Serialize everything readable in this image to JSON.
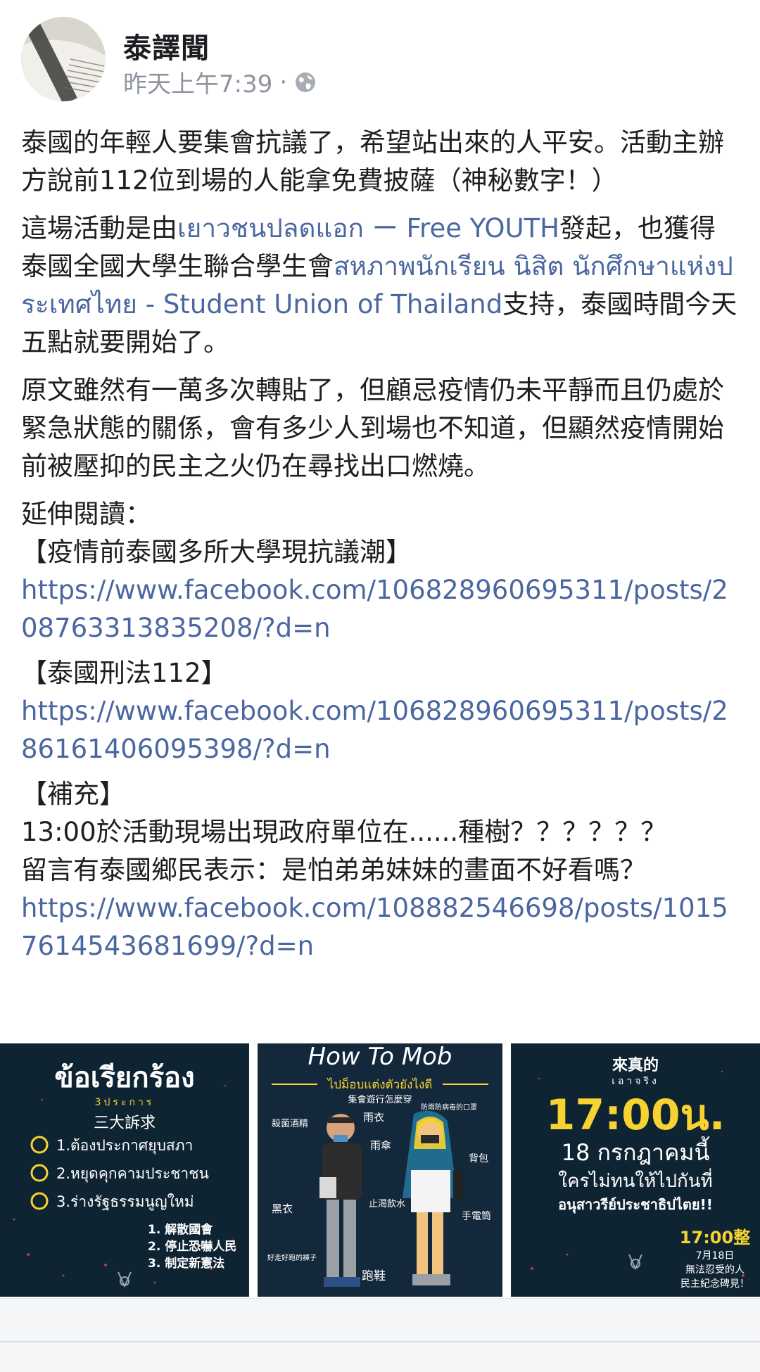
{
  "header": {
    "page_name": "泰譯聞",
    "timestamp": "昨天上午7:39",
    "separator": "·",
    "privacy_icon": "globe-icon"
  },
  "post": {
    "p1": "泰國的年輕人要集會抗議了，希望站出來的人平安。活動主辦方說前112位到場的人能拿免費披薩（神秘數字！）",
    "p2_a": "這場活動是由",
    "p2_link1": "เยาวชนปลดแอก ー Free YOUTH",
    "p2_b": "發起，也獲得泰國全國大學生聯合學生會",
    "p2_link2": "สหภาพนักเรียน นิสิต นักศึกษาแห่งประเทศไทย - Student Union of Thailand",
    "p2_c": "支持，泰國時間今天五點就要開始了。",
    "p3": "原文雖然有一萬多次轉貼了，但顧忌疫情仍未平靜而且仍處於緊急狀態的關係，會有多少人到場也不知道，但顯然疫情開始前被壓抑的民主之火仍在尋找出口燃燒。",
    "further_title": "延伸閱讀：",
    "further_item1": "【疫情前泰國多所大學現抗議潮】",
    "further_link1": "https://www.facebook.com/106828960695311/posts/208763313835208/?d=n",
    "further_item2": "【泰國刑法112】",
    "further_link2": "https://www.facebook.com/106828960695311/posts/286161406095398/?d=n",
    "supp_title": "【補充】",
    "supp_line1": "13:00於活動現場出現政府單位在......種樹？？？？？？",
    "supp_line2": "留言有泰國鄉民表示：是怕弟弟妹妹的畫面不好看嗎？",
    "supp_link": "https://www.facebook.com/108882546698/posts/10157614543681699/?d=n"
  },
  "images": {
    "img1": {
      "title": "ข้อเรียกร้อง",
      "subtitle": "3ประการ",
      "cn_title": "三大訴求",
      "items": [
        "1.ต้องประกาศยุบสภา",
        "2.หยุดคุกคามประชาชน",
        "3.ร่างรัฐธรรมนูญใหม่"
      ],
      "cn_items": [
        "1. 解散國會",
        "2. 停止恐嚇人民",
        "3. 制定新憲法"
      ]
    },
    "img2": {
      "title": "How To Mob",
      "thai_sub": "ไปม็อบแต่งตัวยังไงดี",
      "cn_sub": "集會遊行怎麼穿",
      "labels": {
        "sanitizer": "殺菌酒精",
        "raincoat": "雨衣",
        "umbrella": "雨傘",
        "mask": "防雨防病毒的口罩",
        "backpack": "背包",
        "clothes": "黑衣",
        "water": "止渴飲水",
        "flashlight": "手電筒",
        "shoes_text": "好走好跑的褲子",
        "sneakers": "跑鞋"
      }
    },
    "img3": {
      "top_cn": "來真的",
      "top_thai": "เอาจริง",
      "time": "17:00น.",
      "date": "18 กรกฎาคมนี้",
      "line1": "ใครไม่ทนให้ไปกันที่",
      "line2": "อนุสาวรีย์ประชาธิปไตย!!",
      "cn_time": "17:00整",
      "cn_date": "7月18日",
      "cn_line1": "無法忍受的人",
      "cn_line2": "民主紀念碑見！"
    }
  },
  "colors": {
    "link": "#4b67a1",
    "text": "#1c1e21",
    "meta": "#8d949e",
    "accent_yellow": "#f6d330"
  }
}
